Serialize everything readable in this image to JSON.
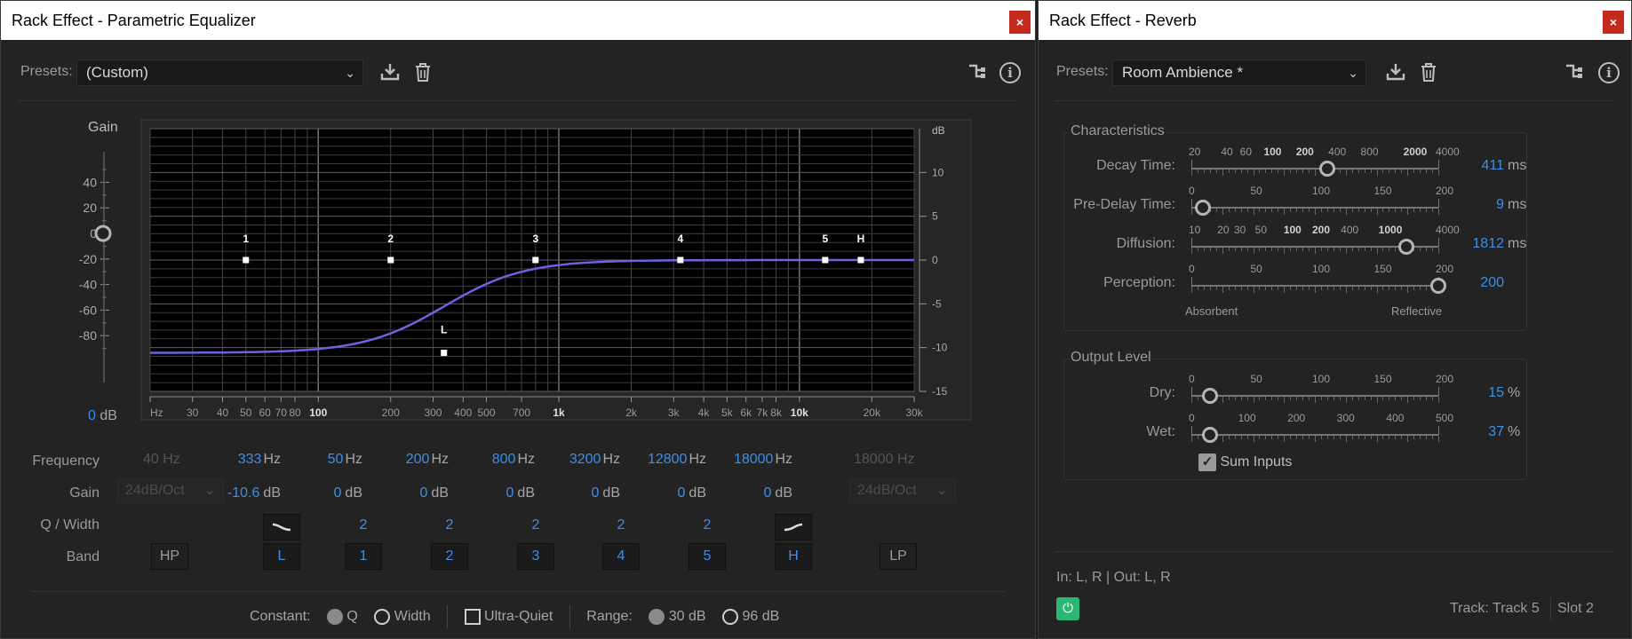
{
  "eq": {
    "title": "Rack Effect - Parametric Equalizer",
    "close": "×",
    "presets_label": "Presets:",
    "preset_value": "(Custom)",
    "graph": {
      "gain_title": "Gain",
      "db_title": "dB",
      "gain_display_value": "0",
      "gain_display_unit": "dB",
      "left_ticks": [
        "40",
        "20",
        "0",
        "-20",
        "-40",
        "-60",
        "-80"
      ],
      "right_ticks": [
        "10",
        "5",
        "0",
        "-5",
        "-10",
        "-15"
      ],
      "freq_ticks": [
        "Hz",
        "30",
        "40",
        "50",
        "60",
        "70",
        "80",
        "100",
        "200",
        "300",
        "400",
        "500",
        "700",
        "1k",
        "2k",
        "3k",
        "4k",
        "5k",
        "6k",
        "7k",
        "8k",
        "10k",
        "20k",
        "30k"
      ],
      "bold_freq_ticks": [
        "100",
        "1k",
        "10k"
      ],
      "node_labels": [
        "1",
        "2",
        "3",
        "4",
        "5",
        "H",
        "L"
      ]
    },
    "row_labels": {
      "frequency": "Frequency",
      "gain": "Gain",
      "q": "Q / Width",
      "band": "Band"
    },
    "hp": {
      "freq": "40 Hz",
      "slope": "24dB/Oct",
      "band": "HP"
    },
    "lp": {
      "freq": "18000 Hz",
      "slope": "24dB/Oct",
      "band": "LP"
    },
    "bands": [
      {
        "id": "L",
        "freq": "333",
        "gain": "-10.6",
        "q": ""
      },
      {
        "id": "1",
        "freq": "50",
        "gain": "0",
        "q": "2"
      },
      {
        "id": "2",
        "freq": "200",
        "gain": "0",
        "q": "2"
      },
      {
        "id": "3",
        "freq": "800",
        "gain": "0",
        "q": "2"
      },
      {
        "id": "4",
        "freq": "3200",
        "gain": "0",
        "q": "2"
      },
      {
        "id": "5",
        "freq": "12800",
        "gain": "0",
        "q": "2"
      },
      {
        "id": "H",
        "freq": "18000",
        "gain": "0",
        "q": ""
      }
    ],
    "hz": "Hz",
    "db": "dB",
    "footer": {
      "constant_label": "Constant:",
      "q_label": "Q",
      "width_label": "Width",
      "ultra_quiet_label": "Ultra-Quiet",
      "range_label": "Range:",
      "range_30": "30 dB",
      "range_96": "96 dB"
    }
  },
  "reverb": {
    "title": "Rack Effect - Reverb",
    "close": "×",
    "presets_label": "Presets:",
    "preset_value": "Room Ambience *",
    "characteristics_title": "Characteristics",
    "decay": {
      "label": "Decay Time:",
      "value": "411",
      "unit": "ms",
      "scale": [
        "20",
        "40",
        "60",
        "100",
        "200",
        "400",
        "800",
        "2000",
        "4000"
      ],
      "level": 0.55
    },
    "predelay": {
      "label": "Pre-Delay Time:",
      "value": "9",
      "unit": "ms",
      "scale": [
        "0",
        "50",
        "100",
        "150",
        "200"
      ],
      "level": 0.045
    },
    "diffusion": {
      "label": "Diffusion:",
      "value": "1812",
      "unit": "ms",
      "scale": [
        "10",
        "20",
        "30",
        "50",
        "100",
        "200",
        "400",
        "1000",
        "4000"
      ],
      "level": 0.87
    },
    "perception": {
      "label": "Perception:",
      "value": "200",
      "scale": [
        "0",
        "50",
        "100",
        "150",
        "200"
      ],
      "left": "Absorbent",
      "right": "Reflective",
      "level": 1.0
    },
    "output_title": "Output Level",
    "dry": {
      "label": "Dry:",
      "value": "15",
      "unit": "%",
      "scale": [
        "0",
        "50",
        "100",
        "150",
        "200"
      ],
      "level": 0.075
    },
    "wet": {
      "label": "Wet:",
      "value": "37",
      "unit": "%",
      "scale": [
        "0",
        "100",
        "200",
        "300",
        "400",
        "500"
      ],
      "level": 0.074
    },
    "sum_inputs": "Sum Inputs",
    "io": "In: L, R | Out: L, R",
    "track": "Track: Track 5",
    "slot": "Slot 2"
  },
  "colors": {
    "accent": "#3d8ee8",
    "curve": "#6b63e0",
    "power": "#2bb673",
    "close": "#c42b1c"
  }
}
